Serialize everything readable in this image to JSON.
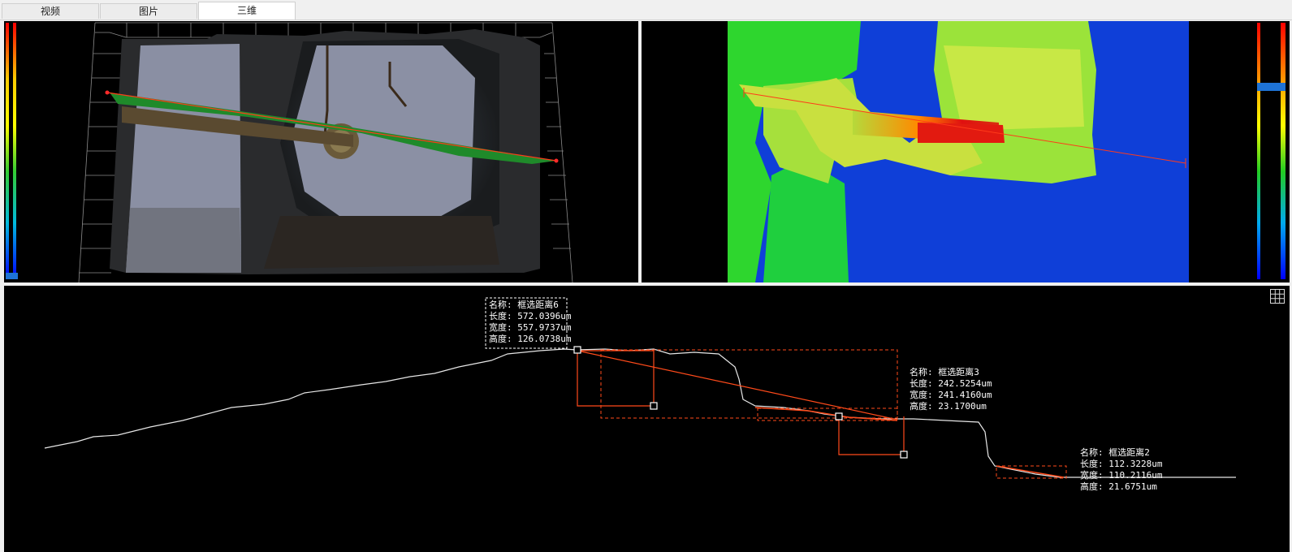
{
  "tabs": [
    {
      "label": "视频",
      "active": false
    },
    {
      "label": "图片",
      "active": false
    },
    {
      "label": "三维",
      "active": true
    }
  ],
  "colors": {
    "measure_line": "#ff3b1a",
    "section_fill": "#1f8a2a",
    "profile_curve": "#e6e6e6",
    "label_text": "#ffffff"
  },
  "profile": {
    "measurements": [
      {
        "name_label": "名称:",
        "name_value": "框选距离6",
        "length_label": "长度:",
        "length_value": "572.0396um",
        "width_label": "宽度:",
        "width_value": "557.9737um",
        "height_label": "高度:",
        "height_value": "126.0738um",
        "boxed": true
      },
      {
        "name_label": "名称:",
        "name_value": "框选距离3",
        "length_label": "长度:",
        "length_value": "242.5254um",
        "width_label": "宽度:",
        "width_value": "241.4160um",
        "height_label": "高度:",
        "height_value": "23.1700um",
        "boxed": false
      },
      {
        "name_label": "名称:",
        "name_value": "框选距离2",
        "length_label": "长度:",
        "length_value": "112.3228um",
        "width_label": "宽度:",
        "width_value": "110.2116um",
        "height_label": "高度:",
        "height_value": "21.6751um",
        "boxed": false
      }
    ]
  },
  "icons": {
    "grid_toggle": "grid-icon",
    "color_scale_left": "color-scale-icon",
    "color_scale_right": "color-scale-slider-icon"
  }
}
